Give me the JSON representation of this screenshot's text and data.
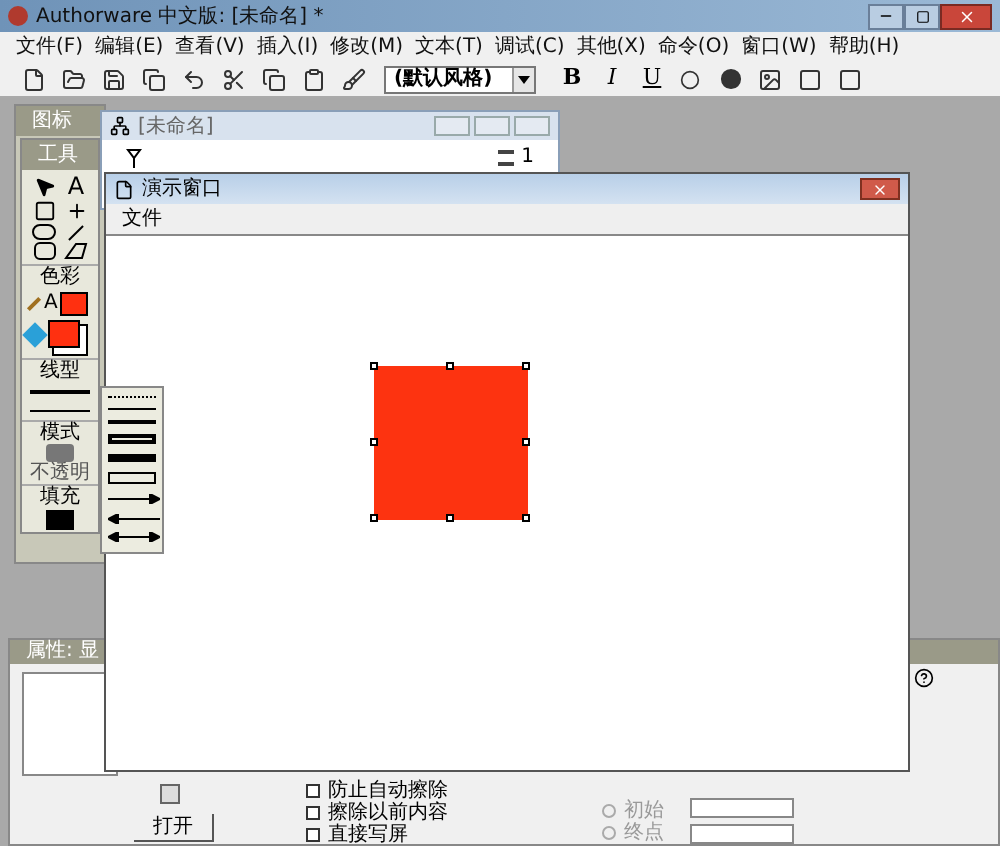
{
  "app": {
    "title": "Authorware 中文版: [未命名] *"
  },
  "menu": [
    "文件(F)",
    "编辑(E)",
    "查看(V)",
    "插入(I)",
    "修改(M)",
    "文本(T)",
    "调试(C)",
    "其他(X)",
    "命令(O)",
    "窗口(W)",
    "帮助(H)"
  ],
  "toolbar": {
    "style_select": "(默认风格)",
    "format_buttons": [
      "B",
      "I",
      "U"
    ]
  },
  "icon_palette": {
    "title": "图标"
  },
  "tools_palette": {
    "title": "工具",
    "text_tool": "A",
    "color_label": "色彩",
    "pen_letter": "A",
    "line_label": "线型",
    "mode_label": "模式",
    "mode_value": "不透明",
    "fill_label": "填充"
  },
  "flowchart_window": {
    "title": "[未命名]",
    "page": "1"
  },
  "presentation_window": {
    "title": "演示窗口",
    "menu": [
      "文件"
    ]
  },
  "properties": {
    "title": "属性: 显",
    "checkboxes": [
      {
        "label": "防止自动擦除",
        "checked": false
      },
      {
        "label": "擦除以前内容",
        "checked": false
      },
      {
        "label": "直接写屏",
        "checked": false
      }
    ],
    "radios": [
      {
        "label": "初始",
        "selected": false
      },
      {
        "label": "终点",
        "selected": false
      }
    ],
    "open_button": "打开"
  }
}
